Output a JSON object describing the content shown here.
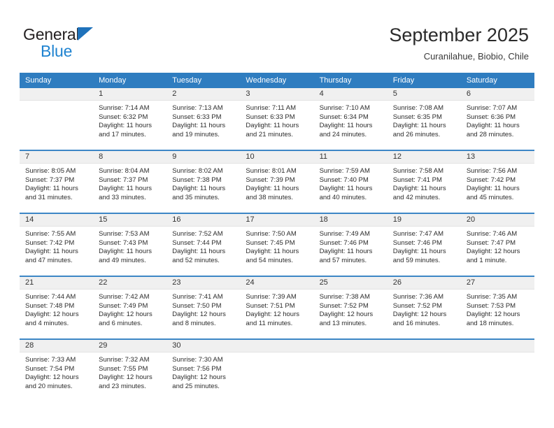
{
  "brand": {
    "line1": "General",
    "line2": "Blue",
    "triangle_color": "#1f72bb",
    "text_color": "#231f20",
    "blue_text_color": "#1f83d0"
  },
  "header": {
    "title": "September 2025",
    "subtitle": "Curanilahue, Biobio, Chile"
  },
  "theme": {
    "header_row_bg": "#2f7dc0",
    "week_divider": "#3d87c6",
    "daynum_band_bg": "#f0f0f0"
  },
  "weekdays": [
    "Sunday",
    "Monday",
    "Tuesday",
    "Wednesday",
    "Thursday",
    "Friday",
    "Saturday"
  ],
  "labels": {
    "sunrise_prefix": "Sunrise:",
    "sunset_prefix": "Sunset:",
    "daylight_prefix": "Daylight:"
  },
  "weeks": [
    [
      {
        "day": "",
        "sunrise": "",
        "sunset": "",
        "daylight_a": "",
        "daylight_b": ""
      },
      {
        "day": "1",
        "sunrise": "Sunrise: 7:14 AM",
        "sunset": "Sunset: 6:32 PM",
        "daylight_a": "Daylight: 11 hours",
        "daylight_b": "and 17 minutes."
      },
      {
        "day": "2",
        "sunrise": "Sunrise: 7:13 AM",
        "sunset": "Sunset: 6:33 PM",
        "daylight_a": "Daylight: 11 hours",
        "daylight_b": "and 19 minutes."
      },
      {
        "day": "3",
        "sunrise": "Sunrise: 7:11 AM",
        "sunset": "Sunset: 6:33 PM",
        "daylight_a": "Daylight: 11 hours",
        "daylight_b": "and 21 minutes."
      },
      {
        "day": "4",
        "sunrise": "Sunrise: 7:10 AM",
        "sunset": "Sunset: 6:34 PM",
        "daylight_a": "Daylight: 11 hours",
        "daylight_b": "and 24 minutes."
      },
      {
        "day": "5",
        "sunrise": "Sunrise: 7:08 AM",
        "sunset": "Sunset: 6:35 PM",
        "daylight_a": "Daylight: 11 hours",
        "daylight_b": "and 26 minutes."
      },
      {
        "day": "6",
        "sunrise": "Sunrise: 7:07 AM",
        "sunset": "Sunset: 6:36 PM",
        "daylight_a": "Daylight: 11 hours",
        "daylight_b": "and 28 minutes."
      }
    ],
    [
      {
        "day": "7",
        "sunrise": "Sunrise: 8:05 AM",
        "sunset": "Sunset: 7:37 PM",
        "daylight_a": "Daylight: 11 hours",
        "daylight_b": "and 31 minutes."
      },
      {
        "day": "8",
        "sunrise": "Sunrise: 8:04 AM",
        "sunset": "Sunset: 7:37 PM",
        "daylight_a": "Daylight: 11 hours",
        "daylight_b": "and 33 minutes."
      },
      {
        "day": "9",
        "sunrise": "Sunrise: 8:02 AM",
        "sunset": "Sunset: 7:38 PM",
        "daylight_a": "Daylight: 11 hours",
        "daylight_b": "and 35 minutes."
      },
      {
        "day": "10",
        "sunrise": "Sunrise: 8:01 AM",
        "sunset": "Sunset: 7:39 PM",
        "daylight_a": "Daylight: 11 hours",
        "daylight_b": "and 38 minutes."
      },
      {
        "day": "11",
        "sunrise": "Sunrise: 7:59 AM",
        "sunset": "Sunset: 7:40 PM",
        "daylight_a": "Daylight: 11 hours",
        "daylight_b": "and 40 minutes."
      },
      {
        "day": "12",
        "sunrise": "Sunrise: 7:58 AM",
        "sunset": "Sunset: 7:41 PM",
        "daylight_a": "Daylight: 11 hours",
        "daylight_b": "and 42 minutes."
      },
      {
        "day": "13",
        "sunrise": "Sunrise: 7:56 AM",
        "sunset": "Sunset: 7:42 PM",
        "daylight_a": "Daylight: 11 hours",
        "daylight_b": "and 45 minutes."
      }
    ],
    [
      {
        "day": "14",
        "sunrise": "Sunrise: 7:55 AM",
        "sunset": "Sunset: 7:42 PM",
        "daylight_a": "Daylight: 11 hours",
        "daylight_b": "and 47 minutes."
      },
      {
        "day": "15",
        "sunrise": "Sunrise: 7:53 AM",
        "sunset": "Sunset: 7:43 PM",
        "daylight_a": "Daylight: 11 hours",
        "daylight_b": "and 49 minutes."
      },
      {
        "day": "16",
        "sunrise": "Sunrise: 7:52 AM",
        "sunset": "Sunset: 7:44 PM",
        "daylight_a": "Daylight: 11 hours",
        "daylight_b": "and 52 minutes."
      },
      {
        "day": "17",
        "sunrise": "Sunrise: 7:50 AM",
        "sunset": "Sunset: 7:45 PM",
        "daylight_a": "Daylight: 11 hours",
        "daylight_b": "and 54 minutes."
      },
      {
        "day": "18",
        "sunrise": "Sunrise: 7:49 AM",
        "sunset": "Sunset: 7:46 PM",
        "daylight_a": "Daylight: 11 hours",
        "daylight_b": "and 57 minutes."
      },
      {
        "day": "19",
        "sunrise": "Sunrise: 7:47 AM",
        "sunset": "Sunset: 7:46 PM",
        "daylight_a": "Daylight: 11 hours",
        "daylight_b": "and 59 minutes."
      },
      {
        "day": "20",
        "sunrise": "Sunrise: 7:46 AM",
        "sunset": "Sunset: 7:47 PM",
        "daylight_a": "Daylight: 12 hours",
        "daylight_b": "and 1 minute."
      }
    ],
    [
      {
        "day": "21",
        "sunrise": "Sunrise: 7:44 AM",
        "sunset": "Sunset: 7:48 PM",
        "daylight_a": "Daylight: 12 hours",
        "daylight_b": "and 4 minutes."
      },
      {
        "day": "22",
        "sunrise": "Sunrise: 7:42 AM",
        "sunset": "Sunset: 7:49 PM",
        "daylight_a": "Daylight: 12 hours",
        "daylight_b": "and 6 minutes."
      },
      {
        "day": "23",
        "sunrise": "Sunrise: 7:41 AM",
        "sunset": "Sunset: 7:50 PM",
        "daylight_a": "Daylight: 12 hours",
        "daylight_b": "and 8 minutes."
      },
      {
        "day": "24",
        "sunrise": "Sunrise: 7:39 AM",
        "sunset": "Sunset: 7:51 PM",
        "daylight_a": "Daylight: 12 hours",
        "daylight_b": "and 11 minutes."
      },
      {
        "day": "25",
        "sunrise": "Sunrise: 7:38 AM",
        "sunset": "Sunset: 7:52 PM",
        "daylight_a": "Daylight: 12 hours",
        "daylight_b": "and 13 minutes."
      },
      {
        "day": "26",
        "sunrise": "Sunrise: 7:36 AM",
        "sunset": "Sunset: 7:52 PM",
        "daylight_a": "Daylight: 12 hours",
        "daylight_b": "and 16 minutes."
      },
      {
        "day": "27",
        "sunrise": "Sunrise: 7:35 AM",
        "sunset": "Sunset: 7:53 PM",
        "daylight_a": "Daylight: 12 hours",
        "daylight_b": "and 18 minutes."
      }
    ],
    [
      {
        "day": "28",
        "sunrise": "Sunrise: 7:33 AM",
        "sunset": "Sunset: 7:54 PM",
        "daylight_a": "Daylight: 12 hours",
        "daylight_b": "and 20 minutes."
      },
      {
        "day": "29",
        "sunrise": "Sunrise: 7:32 AM",
        "sunset": "Sunset: 7:55 PM",
        "daylight_a": "Daylight: 12 hours",
        "daylight_b": "and 23 minutes."
      },
      {
        "day": "30",
        "sunrise": "Sunrise: 7:30 AM",
        "sunset": "Sunset: 7:56 PM",
        "daylight_a": "Daylight: 12 hours",
        "daylight_b": "and 25 minutes."
      },
      {
        "day": "",
        "sunrise": "",
        "sunset": "",
        "daylight_a": "",
        "daylight_b": ""
      },
      {
        "day": "",
        "sunrise": "",
        "sunset": "",
        "daylight_a": "",
        "daylight_b": ""
      },
      {
        "day": "",
        "sunrise": "",
        "sunset": "",
        "daylight_a": "",
        "daylight_b": ""
      },
      {
        "day": "",
        "sunrise": "",
        "sunset": "",
        "daylight_a": "",
        "daylight_b": ""
      }
    ]
  ]
}
